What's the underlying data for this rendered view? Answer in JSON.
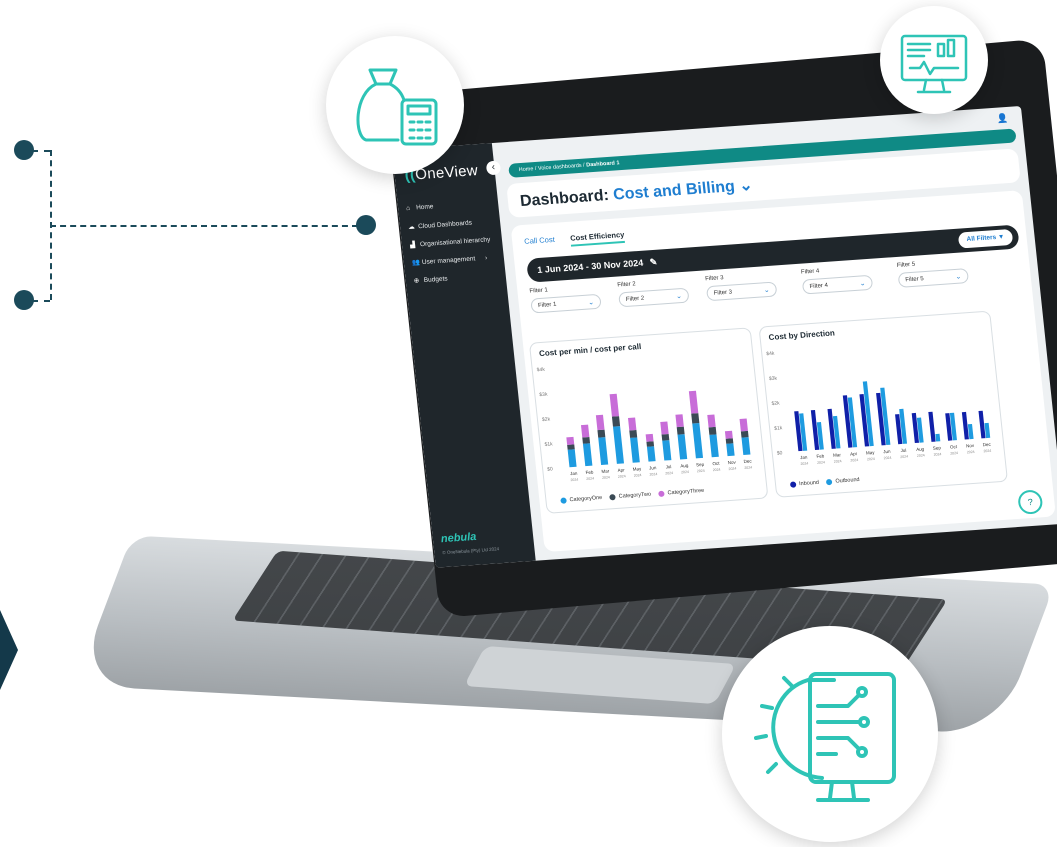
{
  "colors": {
    "accent": "#2ec4b6",
    "teal_dark": "#0f8a85",
    "blue": "#1f7ed0",
    "sidebar": "#1f262b",
    "navy": "#1b4a5a"
  },
  "app": {
    "logo": "OneView",
    "brand": "nebula",
    "copyright": "© OneNebula (Pty) Ltd 2024",
    "user_icon": "user-icon"
  },
  "sidebar": {
    "items": [
      {
        "label": "Home",
        "icon": "home-icon"
      },
      {
        "label": "Cloud Dashboards",
        "icon": "cloud-icon"
      },
      {
        "label": "Organisational hierarchy",
        "icon": "hierarchy-icon"
      },
      {
        "label": "User management",
        "icon": "users-icon"
      },
      {
        "label": "Budgets",
        "icon": "budget-icon"
      }
    ]
  },
  "breadcrumb": {
    "path": "Home / Voice dashboards / ",
    "current": "Dashboard 1"
  },
  "header": {
    "title_prefix": "Dashboard: ",
    "title_highlight": "Cost and Billing",
    "chevron": "⌄"
  },
  "tabs": [
    {
      "label": "Call Cost",
      "active": false
    },
    {
      "label": "Cost Efficiency",
      "active": true
    }
  ],
  "date_range": {
    "label": "1 Jun 2024 - 30 Nov 2024",
    "edit_icon": "pencil-icon",
    "all_filters": "All Filters"
  },
  "filters": [
    {
      "label": "Filter 1",
      "value": "Filter 1"
    },
    {
      "label": "Filter 2",
      "value": "Filter 2"
    },
    {
      "label": "Filter 3",
      "value": "Filter 3"
    },
    {
      "label": "Filter 4",
      "value": "Filter 4"
    },
    {
      "label": "Filter 5",
      "value": "Filter 5"
    }
  ],
  "chart_data": [
    {
      "type": "bar",
      "title": "Cost per min / cost per call",
      "stacked": true,
      "categories": [
        "Jan",
        "Feb",
        "Mar",
        "Apr",
        "May",
        "Jun",
        "Jul",
        "Aug",
        "Sep",
        "Oct",
        "Nov",
        "Dec"
      ],
      "sublabels": [
        "2024",
        "2024",
        "2024",
        "2024",
        "2024",
        "2024",
        "2024",
        "2024",
        "2024",
        "2024",
        "2024",
        "2024"
      ],
      "yticks": [
        "$0",
        "$1k",
        "$2k",
        "$3k",
        "$4k"
      ],
      "ylim": [
        0,
        4000
      ],
      "series": [
        {
          "name": "CategoryOne",
          "color": "#1e9be0",
          "values": [
            700,
            900,
            1100,
            1500,
            1000,
            600,
            800,
            1000,
            1400,
            900,
            500,
            700
          ]
        },
        {
          "name": "CategoryTwo",
          "color": "#3b4a55",
          "values": [
            200,
            250,
            300,
            400,
            300,
            200,
            250,
            300,
            400,
            300,
            200,
            250
          ]
        },
        {
          "name": "CategoryThree",
          "color": "#c86dd8",
          "values": [
            300,
            500,
            600,
            900,
            500,
            300,
            500,
            500,
            900,
            500,
            300,
            500
          ]
        }
      ]
    },
    {
      "type": "bar",
      "title": "Cost by Direction",
      "stacked": false,
      "categories": [
        "Jan",
        "Feb",
        "Mar",
        "Apr",
        "May",
        "Jun",
        "Jul",
        "Aug",
        "Sep",
        "Oct",
        "Nov",
        "Dec"
      ],
      "sublabels": [
        "2024",
        "2024",
        "2024",
        "2024",
        "2024",
        "2024",
        "2024",
        "2024",
        "2024",
        "2024",
        "2024",
        "2024"
      ],
      "yticks": [
        "$0",
        "$1k",
        "$2k",
        "$3k",
        "$4k"
      ],
      "ylim": [
        0,
        4000
      ],
      "series": [
        {
          "name": "Inbound",
          "color": "#1020a8",
          "values": [
            1600,
            1600,
            1600,
            2100,
            2100,
            2100,
            1200,
            1200,
            1200,
            1100,
            1100,
            1100
          ]
        },
        {
          "name": "Outbound",
          "color": "#1e9be0",
          "values": [
            1500,
            1100,
            1300,
            2000,
            2600,
            2300,
            1400,
            1000,
            300,
            1100,
            600,
            600
          ]
        }
      ]
    }
  ],
  "feature_icons": [
    "money-bag-calculator-icon",
    "monitor-analytics-icon",
    "gear-circuit-monitor-icon"
  ],
  "help_icon": "chat-help-icon"
}
